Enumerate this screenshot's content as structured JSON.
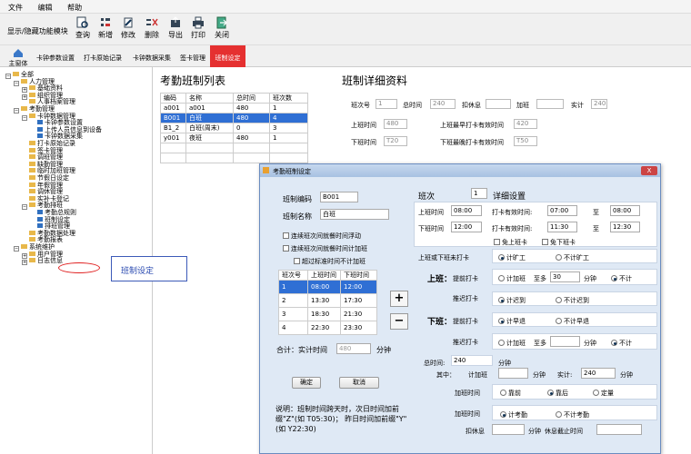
{
  "menu": {
    "items": [
      "文件",
      "编辑",
      "帮助"
    ]
  },
  "toolbar": {
    "toggle_label": "显示/隐藏功能模块",
    "buttons": [
      "查询",
      "新增",
      "修改",
      "删除",
      "导出",
      "打印",
      "关闭"
    ]
  },
  "subtoolbar": {
    "home_label": "主窗体",
    "tabs": [
      "卡钟参数设置",
      "打卡原始记录",
      "卡钟数据采集",
      "签卡管理",
      "班制设定"
    ]
  },
  "tree": {
    "nodes": [
      {
        "label": "全部",
        "level": 0,
        "fold": "-"
      },
      {
        "label": "人力管理",
        "level": 1,
        "fold": "-"
      },
      {
        "label": "基础资料",
        "level": 2,
        "fold": "+"
      },
      {
        "label": "组织管理",
        "level": 2,
        "fold": "+"
      },
      {
        "label": "人事档案管理",
        "level": 2,
        "fold": ""
      },
      {
        "label": "考勤管理",
        "level": 1,
        "fold": "-"
      },
      {
        "label": "卡钟数据管理",
        "level": 2,
        "fold": "-"
      },
      {
        "label": "卡钟参数设置",
        "level": 3,
        "fold": ""
      },
      {
        "label": "上传人员信息到设备",
        "level": 3,
        "fold": ""
      },
      {
        "label": "卡钟数据采集",
        "level": 3,
        "fold": ""
      },
      {
        "label": "打卡原始记录",
        "level": 2,
        "fold": ""
      },
      {
        "label": "签卡管理",
        "level": 2,
        "fold": ""
      },
      {
        "label": "调班管理",
        "level": 2,
        "fold": ""
      },
      {
        "label": "缺勤管理",
        "level": 2,
        "fold": ""
      },
      {
        "label": "临时加班管理",
        "level": 2,
        "fold": ""
      },
      {
        "label": "节假日设定",
        "level": 2,
        "fold": ""
      },
      {
        "label": "年假管理",
        "level": 2,
        "fold": ""
      },
      {
        "label": "调休管理",
        "level": 2,
        "fold": ""
      },
      {
        "label": "实补卡登记",
        "level": 2,
        "fold": ""
      },
      {
        "label": "考勤排班",
        "level": 2,
        "fold": "-"
      },
      {
        "label": "考勤总规则",
        "level": 3,
        "fold": ""
      },
      {
        "label": "班制设定",
        "level": 3,
        "fold": ""
      },
      {
        "label": "排班管理",
        "level": 3,
        "fold": ""
      },
      {
        "label": "考勤数据处理",
        "level": 2,
        "fold": ""
      },
      {
        "label": "考勤报表",
        "level": 2,
        "fold": ""
      },
      {
        "label": "系统维护",
        "level": 1,
        "fold": "-"
      },
      {
        "label": "用户管理",
        "level": 2,
        "fold": "+"
      },
      {
        "label": "日志信息",
        "level": 2,
        "fold": "+"
      }
    ]
  },
  "annotation": {
    "label": "班制设定"
  },
  "list": {
    "title": "考勤班制列表",
    "headers": [
      "编码",
      "名称",
      "总时间",
      "班次数"
    ],
    "rows": [
      [
        "a001",
        "a001",
        "480",
        "1"
      ],
      [
        "B001",
        "白班",
        "480",
        "4"
      ],
      [
        "B1_2",
        "白班(周末)",
        "0",
        "3"
      ],
      [
        "y001",
        "夜班",
        "480",
        "1"
      ]
    ],
    "selected_index": 1
  },
  "detail": {
    "title": "班制详细资料",
    "banci_label": "班次号",
    "banci": "1",
    "total_label": "总时间",
    "total": "240",
    "rest_label": "扣休息",
    "rest": "",
    "ot_label": "加班",
    "ot": "",
    "actual_label": "实计",
    "actual": "240",
    "on_label": "上班时间",
    "on": "480",
    "early_label": "上班最早打卡有效时间",
    "early": "420",
    "off_label": "下班时间",
    "off": "T20",
    "late_label": "下班最晚打卡有效时间",
    "late": "T50"
  },
  "dialog": {
    "title": "考勤班制设定",
    "close": "X",
    "code_label": "班制编码",
    "code": "B001",
    "name_label": "班制名称",
    "name": "白班",
    "opt1": "连续班次间就餐时间浮动",
    "opt2": "连续班次间就餐时间计加班",
    "opt3": "超过标准时间不计加班",
    "shift_headers": [
      "班次号",
      "上班时间",
      "下班时间"
    ],
    "shifts": [
      [
        "1",
        "08:00",
        "12:00"
      ],
      [
        "2",
        "13:30",
        "17:30"
      ],
      [
        "3",
        "18:30",
        "21:30"
      ],
      [
        "4",
        "22:30",
        "23:30"
      ]
    ],
    "selected_shift": 0,
    "add": "+",
    "remove": "−",
    "total_label": "合计：实计时间",
    "total": "480",
    "total_unit": "分钟",
    "ok": "确定",
    "cancel": "取消",
    "note": "说明：班制时间跨天时，次日时间加前缀\"Z\"(如 T05:30)； 昨日时间加前缀\"Y\"(如 Y22:30)",
    "banci_label": "班次",
    "banci": "1",
    "detail_title": "详细设置",
    "on_label": "上班时间",
    "on": "08:00",
    "valid1_label": "打卡有效时间:",
    "valid1_from": "07:00",
    "to1": "至",
    "valid1_to": "08:00",
    "off_label": "下班时间",
    "off": "12:00",
    "valid2_label": "打卡有效时间:",
    "valid2_from": "11:30",
    "to2": "至",
    "valid2_to": "12:30",
    "free_on": "免上班卡",
    "free_off": "免下班卡",
    "punch_label": "上班或下班未打卡",
    "work_yes": "计旷工",
    "work_no": "不计旷工",
    "on_head": "上班：",
    "early_on_label": "提前打卡",
    "early_on_opt1": "计加班",
    "early_on_most": "至多",
    "early_on_val": "30",
    "early_on_unit": "分钟",
    "early_on_opt2": "不计",
    "late_on_label": "推迟打卡",
    "late_on_opt1": "计迟到",
    "late_on_opt2": "不计迟到",
    "off_head": "下班：",
    "early_off_label": "提前打卡",
    "early_off_opt1": "计早退",
    "early_off_opt2": "不计早退",
    "late_off_label": "推迟打卡",
    "late_off_opt1": "计加班",
    "late_off_most": "至多",
    "late_off_unit": "分钟",
    "late_off_opt2": "不计",
    "total_time_label": "总时间:",
    "total_time": "240",
    "total_time_unit": "分钟",
    "among_label": "其中：",
    "ot_label": "计加班",
    "ot_unit": "分钟",
    "real_label": "实计:",
    "real": "240",
    "real_unit": "分钟",
    "ot_time_label": "加班时间",
    "ot_pre": "靠前",
    "ot_post": "靠后",
    "ot_fixed": "定量",
    "ot_time2_label": "加班时间",
    "ot2_att": "计考勤",
    "ot2_noatt": "不计考勤",
    "rest_label": "扣休息",
    "rest_unit": "分钟",
    "rest_end_label": "休息截止时间"
  }
}
